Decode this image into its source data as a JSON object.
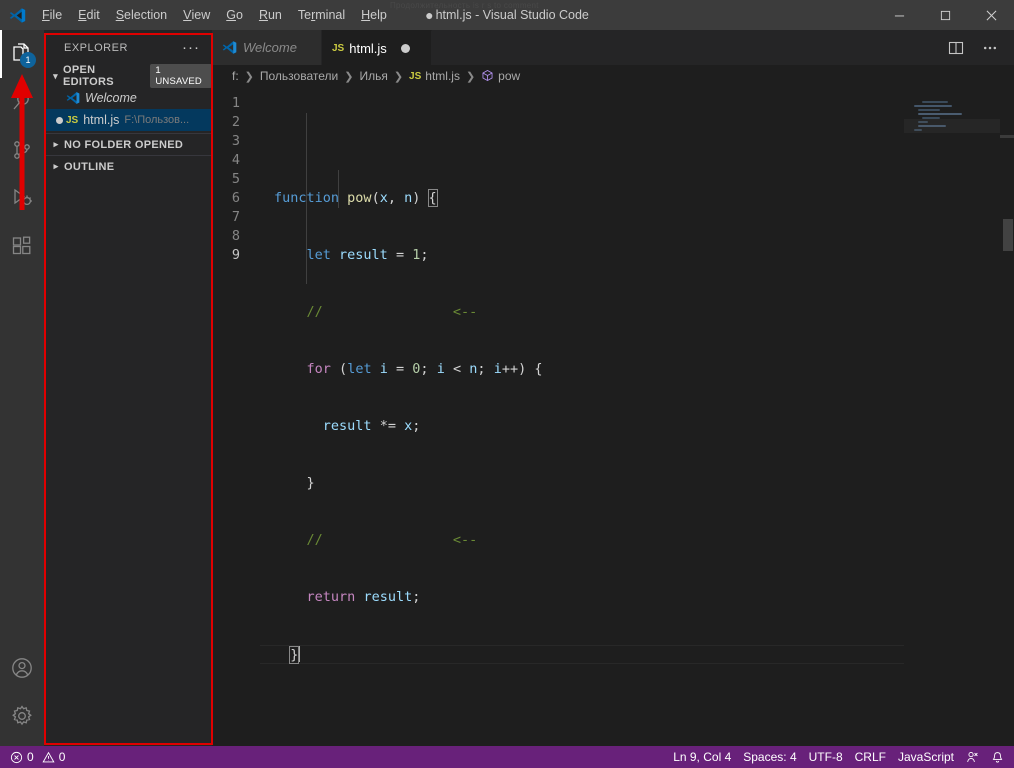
{
  "window": {
    "title": "html.js - Visual Studio Code",
    "dirty_marker": "●",
    "ghost_text": "Продолжительность is r s to comment",
    "controls": {
      "minimize": "minimize-icon",
      "maximize": "maximize-icon",
      "close": "close-icon"
    }
  },
  "menu": {
    "items": [
      {
        "label": "File",
        "mnemonic": "F"
      },
      {
        "label": "Edit",
        "mnemonic": "E"
      },
      {
        "label": "Selection",
        "mnemonic": "S"
      },
      {
        "label": "View",
        "mnemonic": "V"
      },
      {
        "label": "Go",
        "mnemonic": "G"
      },
      {
        "label": "Run",
        "mnemonic": "R"
      },
      {
        "label": "Terminal",
        "mnemonic": "T"
      },
      {
        "label": "Help",
        "mnemonic": "H"
      }
    ]
  },
  "activitybar": {
    "items": [
      {
        "name": "explorer",
        "icon": "files-icon",
        "badge": "1",
        "active": true
      },
      {
        "name": "search",
        "icon": "search-icon",
        "badge": "",
        "active": false
      },
      {
        "name": "source-control",
        "icon": "source-control-icon",
        "badge": "",
        "active": false
      },
      {
        "name": "run-debug",
        "icon": "run-and-debug-icon",
        "badge": "",
        "active": false
      },
      {
        "name": "extensions",
        "icon": "extensions-icon",
        "badge": "",
        "active": false
      }
    ],
    "bottom": [
      {
        "name": "accounts",
        "icon": "account-icon"
      },
      {
        "name": "settings",
        "icon": "gear-icon"
      }
    ]
  },
  "sidebar": {
    "title": "EXPLORER",
    "more_actions": "···",
    "sections": [
      {
        "label": "OPEN EDITORS",
        "expanded": true,
        "badge": "1 UNSAVED",
        "items": [
          {
            "label": "Welcome",
            "icon": "vscode-logo-icon",
            "italic": true,
            "dirty": false,
            "path": ""
          },
          {
            "label": "html.js",
            "icon": "js-icon",
            "italic": false,
            "dirty": true,
            "path": "F:\\Пользов..."
          }
        ]
      },
      {
        "label": "NO FOLDER OPENED",
        "expanded": false,
        "badge": "",
        "items": []
      },
      {
        "label": "OUTLINE",
        "expanded": false,
        "badge": "",
        "items": []
      }
    ]
  },
  "tabs": [
    {
      "label": "Welcome",
      "icon": "vscode-logo-icon",
      "active": false,
      "dirty": false,
      "italic": true
    },
    {
      "label": "html.js",
      "icon": "js-icon",
      "active": true,
      "dirty": true,
      "italic": false
    }
  ],
  "tab_actions": [
    {
      "name": "split-editor",
      "icon": "split-editor-icon"
    },
    {
      "name": "more-actions",
      "icon": "ellipsis-icon"
    }
  ],
  "breadcrumb": [
    {
      "label": "f:",
      "icon": ""
    },
    {
      "label": "Пользователи",
      "icon": ""
    },
    {
      "label": "Илья",
      "icon": ""
    },
    {
      "label": "html.js",
      "icon": "js-icon"
    },
    {
      "label": "pow",
      "icon": "symbol-method-icon"
    }
  ],
  "editor": {
    "language": "JavaScript",
    "line_numbers": [
      "1",
      "2",
      "3",
      "4",
      "5",
      "6",
      "7",
      "8",
      "9"
    ],
    "lines": [
      "function pow(x, n) {",
      "    let result = 1;",
      "    //                <--",
      "    for (let i = 0; i < n; i++) {",
      "      result *= x;",
      "    }",
      "    //                <--",
      "    return result;",
      "  }"
    ],
    "current_line": 9
  },
  "statusbar": {
    "left": [
      {
        "name": "problems",
        "icon": "error-icon",
        "errors": "0",
        "warnings": "0",
        "warn_icon": "warning-icon"
      }
    ],
    "right": [
      {
        "name": "cursor-position",
        "label": "Ln 9, Col 4"
      },
      {
        "name": "indentation",
        "label": "Spaces: 4"
      },
      {
        "name": "encoding",
        "label": "UTF-8"
      },
      {
        "name": "line-endings",
        "label": "CRLF"
      },
      {
        "name": "language-mode",
        "label": "JavaScript"
      },
      {
        "name": "feedback",
        "label": "",
        "icon": "feedback-icon"
      },
      {
        "name": "notifications",
        "label": "",
        "icon": "bell-icon"
      }
    ]
  },
  "annotations": {
    "rect_color": "#e00000",
    "arrow_color": "#e00000"
  },
  "colors": {
    "titlebar_bg": "#3c3c3c",
    "activitybar_bg": "#333333",
    "sidebar_bg": "#252526",
    "editor_bg": "#1e1e1e",
    "statusbar_bg": "#68217a",
    "badge_bg": "#0e639c",
    "accent": "#007acc"
  }
}
